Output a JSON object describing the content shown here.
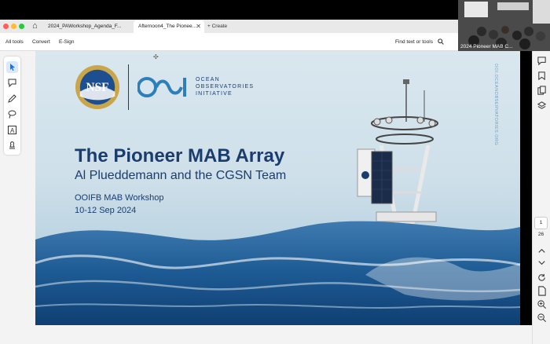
{
  "tabs": [
    {
      "label": "2024_PAWorkshop_Agenda_F...",
      "active": false
    },
    {
      "label": "Afternoon4_The Pionee...",
      "active": true
    }
  ],
  "create_tab_label": "Create",
  "toolbar": {
    "all_tools": "All tools",
    "convert": "Convert",
    "esign": "E-Sign",
    "find": "Find text or tools"
  },
  "video": {
    "label": "2024 Pioneer MAB C..."
  },
  "page_nav": {
    "current": "1",
    "total": "26"
  },
  "slide": {
    "logo_nsf": "NSF",
    "ooi_line1": "OCEAN",
    "ooi_line2": "OBSERVATORIES",
    "ooi_line3": "INITIATIVE",
    "title": "The Pioneer MAB Array",
    "subtitle": "Al Plueddemann and the CGSN Team",
    "event": "OOIFB MAB Workshop",
    "dates": "10-12 Sep 2024",
    "vertical_text": "OOI.OCEANOBSERVATORIES.ORG"
  },
  "colors": {
    "brand_navy": "#1a3d6d",
    "ooi_teal": "#2c7fb8",
    "buoy_yellow": "#f1c232",
    "selection_blue": "#1473e6"
  }
}
